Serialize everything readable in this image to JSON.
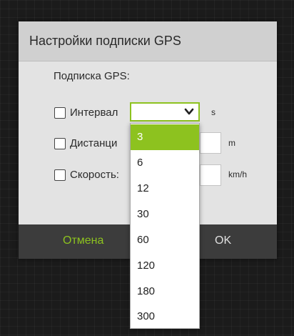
{
  "dialog": {
    "title": "Настройки подписки GPS",
    "section_title": "Подписка GPS:",
    "rows": [
      {
        "label": "Интервал",
        "unit": "s",
        "checked": false
      },
      {
        "label": "Дистанци",
        "unit": "m",
        "checked": false
      },
      {
        "label": "Скорость:",
        "unit": "km/h",
        "checked": false
      }
    ],
    "cancel_label": "Отмена",
    "ok_label": "OK"
  },
  "dropdown": {
    "selected": "3",
    "options": [
      "3",
      "6",
      "12",
      "30",
      "60",
      "120",
      "180",
      "300"
    ]
  },
  "colors": {
    "accent": "#8dc21f",
    "dialog_bg": "#e3e3e3",
    "header_bg": "#d0d0d0",
    "footer_bg": "#3c3c3c",
    "page_bg": "#1b1b1b"
  },
  "icons": {
    "select_chevron": "chevron-down-icon"
  }
}
